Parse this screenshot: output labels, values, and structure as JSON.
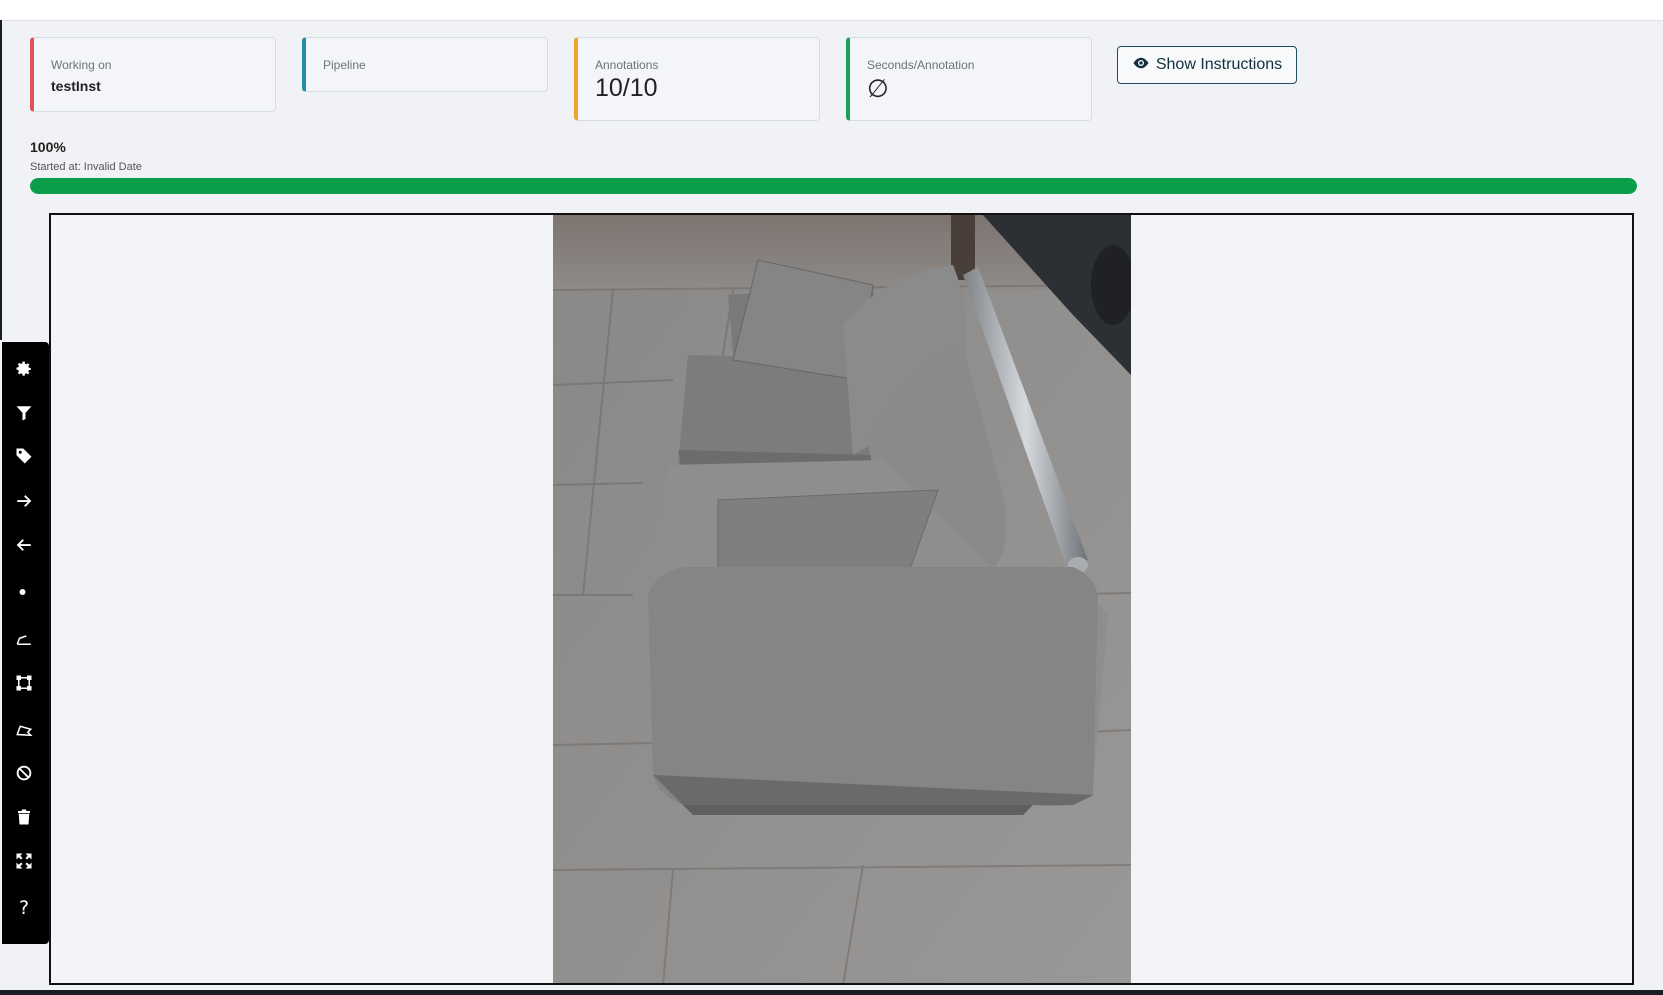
{
  "stats": {
    "working_on": {
      "label": "Working on",
      "value": "testInst"
    },
    "pipeline": {
      "label": "Pipeline"
    },
    "annotations": {
      "label": "Annotations",
      "value": "10/10"
    },
    "seconds": {
      "label": "Seconds/Annotation",
      "value": "∅"
    }
  },
  "instructions_button": {
    "label": "Show Instructions",
    "icon": "eye-icon"
  },
  "progress": {
    "percent_label": "100%",
    "started_label": "Started at: Invalid Date",
    "fraction": 1.0,
    "color": "#0a9e4a"
  },
  "toolbar": {
    "tools": [
      {
        "icon": "gear-icon"
      },
      {
        "icon": "filter-icon"
      },
      {
        "icon": "tag-icon"
      },
      {
        "icon": "arrow-right-icon"
      },
      {
        "icon": "arrow-left-icon"
      },
      {
        "icon": "point-icon"
      },
      {
        "icon": "line-icon"
      },
      {
        "icon": "bbox-icon"
      },
      {
        "icon": "polygon-icon"
      },
      {
        "icon": "ban-icon"
      },
      {
        "icon": "trash-icon"
      },
      {
        "icon": "fullscreen-icon"
      },
      {
        "icon": "help-icon",
        "text": "?"
      }
    ]
  },
  "colors": {
    "working_on": "#e05356",
    "pipeline": "#1f8fa3",
    "annotations": "#f0a430",
    "seconds": "#1ba255"
  }
}
